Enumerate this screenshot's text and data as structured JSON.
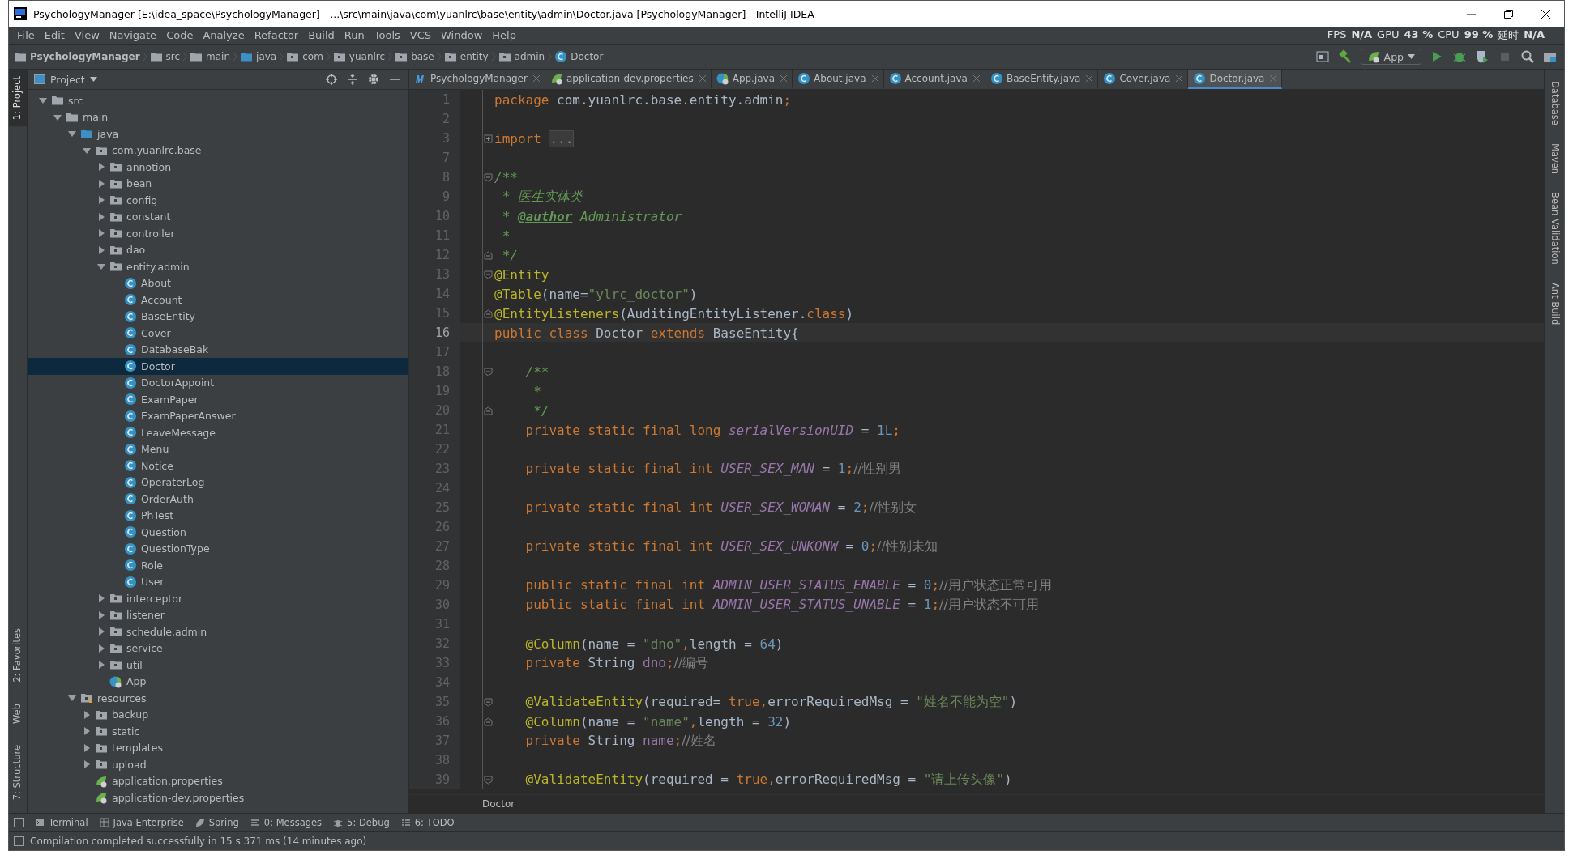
{
  "window": {
    "title": "PsychologyManager [E:\\idea_space\\PsychologyManager] - ...\\src\\main\\java\\com\\yuanlrc\\base\\entity\\admin\\Doctor.java [PsychologyManager] - IntelliJ IDEA"
  },
  "menu": [
    "File",
    "Edit",
    "View",
    "Navigate",
    "Code",
    "Analyze",
    "Refactor",
    "Build",
    "Run",
    "Tools",
    "VCS",
    "Window",
    "Help"
  ],
  "perf_overlay": [
    {
      "label": "FPS",
      "value": "N/A"
    },
    {
      "label": "GPU",
      "value": "43 %"
    },
    {
      "label": "CPU",
      "value": "99 %"
    },
    {
      "label": "延时",
      "value": "N/A"
    }
  ],
  "breadcrumb": [
    {
      "label": "PsychologyManager",
      "kind": "project"
    },
    {
      "label": "src",
      "kind": "folder"
    },
    {
      "label": "main",
      "kind": "folder"
    },
    {
      "label": "java",
      "kind": "source"
    },
    {
      "label": "com",
      "kind": "package"
    },
    {
      "label": "yuanlrc",
      "kind": "package"
    },
    {
      "label": "base",
      "kind": "package"
    },
    {
      "label": "entity",
      "kind": "package"
    },
    {
      "label": "admin",
      "kind": "package"
    },
    {
      "label": "Doctor",
      "kind": "class"
    }
  ],
  "run_config": {
    "label": "App"
  },
  "left_strip": {
    "top": [
      {
        "label": "1: Project",
        "selected": true
      }
    ],
    "bottom": [
      {
        "label": "2: Favorites",
        "selected": false
      },
      {
        "label": "Web",
        "selected": false
      },
      {
        "label": "7: Structure",
        "selected": false
      }
    ]
  },
  "right_strip": [
    "Database",
    "Maven",
    "Bean Validation",
    "Ant Build"
  ],
  "project": {
    "title": "Project",
    "tree": [
      {
        "label": "src",
        "kind": "folder",
        "expanded": true,
        "selected": false,
        "children": [
          {
            "label": "main",
            "kind": "folder",
            "expanded": true,
            "selected": false,
            "children": [
              {
                "label": "java",
                "kind": "source",
                "expanded": true,
                "selected": false,
                "children": [
                  {
                    "label": "com.yuanlrc.base",
                    "kind": "package",
                    "expanded": true,
                    "selected": false,
                    "children": [
                      {
                        "label": "annotion",
                        "kind": "package",
                        "expanded": false,
                        "selected": false
                      },
                      {
                        "label": "bean",
                        "kind": "package",
                        "expanded": false,
                        "selected": false
                      },
                      {
                        "label": "config",
                        "kind": "package",
                        "expanded": false,
                        "selected": false
                      },
                      {
                        "label": "constant",
                        "kind": "package",
                        "expanded": false,
                        "selected": false
                      },
                      {
                        "label": "controller",
                        "kind": "package",
                        "expanded": false,
                        "selected": false
                      },
                      {
                        "label": "dao",
                        "kind": "package",
                        "expanded": false,
                        "selected": false
                      },
                      {
                        "label": "entity.admin",
                        "kind": "package",
                        "expanded": true,
                        "selected": false,
                        "children": [
                          {
                            "label": "About",
                            "kind": "class",
                            "selected": false
                          },
                          {
                            "label": "Account",
                            "kind": "class",
                            "selected": false
                          },
                          {
                            "label": "BaseEntity",
                            "kind": "class",
                            "selected": false
                          },
                          {
                            "label": "Cover",
                            "kind": "class",
                            "selected": false
                          },
                          {
                            "label": "DatabaseBak",
                            "kind": "class",
                            "selected": false
                          },
                          {
                            "label": "Doctor",
                            "kind": "class",
                            "selected": true
                          },
                          {
                            "label": "DoctorAppoint",
                            "kind": "class",
                            "selected": false
                          },
                          {
                            "label": "ExamPaper",
                            "kind": "class",
                            "selected": false
                          },
                          {
                            "label": "ExamPaperAnswer",
                            "kind": "class",
                            "selected": false
                          },
                          {
                            "label": "LeaveMessage",
                            "kind": "class",
                            "selected": false
                          },
                          {
                            "label": "Menu",
                            "kind": "class",
                            "selected": false
                          },
                          {
                            "label": "Notice",
                            "kind": "class",
                            "selected": false
                          },
                          {
                            "label": "OperaterLog",
                            "kind": "class",
                            "selected": false
                          },
                          {
                            "label": "OrderAuth",
                            "kind": "class",
                            "selected": false
                          },
                          {
                            "label": "PhTest",
                            "kind": "class",
                            "selected": false
                          },
                          {
                            "label": "Question",
                            "kind": "class",
                            "selected": false
                          },
                          {
                            "label": "QuestionType",
                            "kind": "class",
                            "selected": false
                          },
                          {
                            "label": "Role",
                            "kind": "class",
                            "selected": false
                          },
                          {
                            "label": "User",
                            "kind": "class",
                            "selected": false
                          }
                        ]
                      },
                      {
                        "label": "interceptor",
                        "kind": "package",
                        "expanded": false,
                        "selected": false
                      },
                      {
                        "label": "listener",
                        "kind": "package",
                        "expanded": false,
                        "selected": false
                      },
                      {
                        "label": "schedule.admin",
                        "kind": "package",
                        "expanded": false,
                        "selected": false
                      },
                      {
                        "label": "service",
                        "kind": "package",
                        "expanded": false,
                        "selected": false
                      },
                      {
                        "label": "util",
                        "kind": "package",
                        "expanded": false,
                        "selected": false
                      },
                      {
                        "label": "App",
                        "kind": "spring-class",
                        "selected": false
                      }
                    ]
                  }
                ]
              },
              {
                "label": "resources",
                "kind": "resources",
                "expanded": true,
                "selected": false,
                "children": [
                  {
                    "label": "backup",
                    "kind": "package",
                    "expanded": false,
                    "selected": false
                  },
                  {
                    "label": "static",
                    "kind": "package",
                    "expanded": false,
                    "selected": false
                  },
                  {
                    "label": "templates",
                    "kind": "package",
                    "expanded": false,
                    "selected": false
                  },
                  {
                    "label": "upload",
                    "kind": "package",
                    "expanded": false,
                    "selected": false
                  },
                  {
                    "label": "application.properties",
                    "kind": "spring-file",
                    "selected": false
                  },
                  {
                    "label": "application-dev.properties",
                    "kind": "spring-file",
                    "selected": false
                  }
                ]
              }
            ]
          }
        ]
      }
    ]
  },
  "editor_tabs": [
    {
      "label": "PsychologyManager",
      "kind": "maven",
      "selected": false
    },
    {
      "label": "application-dev.properties",
      "kind": "spring-file",
      "selected": false
    },
    {
      "label": "App.java",
      "kind": "spring-class",
      "selected": false
    },
    {
      "label": "About.java",
      "kind": "class",
      "selected": false
    },
    {
      "label": "Account.java",
      "kind": "class",
      "selected": false
    },
    {
      "label": "BaseEntity.java",
      "kind": "class",
      "selected": false
    },
    {
      "label": "Cover.java",
      "kind": "class",
      "selected": false
    },
    {
      "label": "Doctor.java",
      "kind": "class",
      "selected": true
    }
  ],
  "code": [
    {
      "number": "1",
      "current": false,
      "tokens": [
        {
          "text": "package ",
          "kind": "keyword"
        },
        {
          "text": "com.yuanlrc.base.entity.admin",
          "kind": "plain"
        },
        {
          "text": ";",
          "kind": "keyword"
        }
      ]
    },
    {
      "number": "2",
      "current": false
    },
    {
      "number": "3",
      "current": false,
      "fold": {
        "kind": "collapsed"
      },
      "tokens": [
        {
          "text": "import ",
          "kind": "keyword"
        },
        {
          "text": "...",
          "kind": "folded"
        }
      ]
    },
    {
      "number": "7",
      "current": false
    },
    {
      "number": "8",
      "current": false,
      "fold": {
        "kind": "start"
      },
      "tokens": [
        {
          "text": "/**",
          "kind": "doc"
        }
      ]
    },
    {
      "number": "9",
      "current": false,
      "tokens": [
        {
          "text": " * 医生实体类",
          "kind": "doc"
        }
      ]
    },
    {
      "number": "10",
      "current": false,
      "tokens": [
        {
          "text": " * ",
          "kind": "doc"
        },
        {
          "text": "@author",
          "kind": "tag"
        },
        {
          "text": " Administrator",
          "kind": "doc"
        }
      ]
    },
    {
      "number": "11",
      "current": false,
      "tokens": [
        {
          "text": " *",
          "kind": "doc"
        }
      ]
    },
    {
      "number": "12",
      "current": false,
      "fold": {
        "kind": "end"
      },
      "tokens": [
        {
          "text": " */",
          "kind": "doc"
        }
      ]
    },
    {
      "number": "13",
      "current": false,
      "fold": {
        "kind": "start"
      },
      "tokens": [
        {
          "text": "@Entity",
          "kind": "annotation"
        }
      ]
    },
    {
      "number": "14",
      "current": false,
      "tokens": [
        {
          "text": "@Table",
          "kind": "annotation"
        },
        {
          "text": "(name=",
          "kind": "plain"
        },
        {
          "text": "\"ylrc_doctor\"",
          "kind": "string"
        },
        {
          "text": ")",
          "kind": "plain"
        }
      ]
    },
    {
      "number": "15",
      "current": false,
      "fold": {
        "kind": "end"
      },
      "tokens": [
        {
          "text": "@EntityListeners",
          "kind": "annotation"
        },
        {
          "text": "(AuditingEntityListener.",
          "kind": "plain"
        },
        {
          "text": "class",
          "kind": "keyword"
        },
        {
          "text": ")",
          "kind": "plain"
        }
      ]
    },
    {
      "number": "16",
      "current": true,
      "tokens": [
        {
          "text": "public class ",
          "kind": "keyword"
        },
        {
          "text": "Doctor",
          "kind": "plain"
        },
        {
          "text": " extends ",
          "kind": "keyword"
        },
        {
          "text": "BaseEntity{",
          "kind": "plain"
        }
      ]
    },
    {
      "number": "17",
      "current": false
    },
    {
      "number": "18",
      "current": false,
      "fold": {
        "kind": "start"
      },
      "tokens": [
        {
          "text": "    /**",
          "kind": "doc"
        }
      ]
    },
    {
      "number": "19",
      "current": false,
      "tokens": [
        {
          "text": "     *",
          "kind": "doc"
        }
      ]
    },
    {
      "number": "20",
      "current": false,
      "fold": {
        "kind": "end"
      },
      "tokens": [
        {
          "text": "     */",
          "kind": "doc"
        }
      ]
    },
    {
      "number": "21",
      "current": false,
      "tokens": [
        {
          "text": "    private static final long ",
          "kind": "keyword"
        },
        {
          "text": "serialVersionUID",
          "kind": "field"
        },
        {
          "text": " = ",
          "kind": "plain"
        },
        {
          "text": "1L",
          "kind": "number"
        },
        {
          "text": ";",
          "kind": "keyword"
        }
      ]
    },
    {
      "number": "22",
      "current": false
    },
    {
      "number": "23",
      "current": false,
      "tokens": [
        {
          "text": "    private static final int ",
          "kind": "keyword"
        },
        {
          "text": "USER_SEX_MAN",
          "kind": "field"
        },
        {
          "text": " = ",
          "kind": "plain"
        },
        {
          "text": "1",
          "kind": "number"
        },
        {
          "text": ";",
          "kind": "keyword"
        },
        {
          "text": "//性别男",
          "kind": "comment"
        }
      ]
    },
    {
      "number": "24",
      "current": false
    },
    {
      "number": "25",
      "current": false,
      "tokens": [
        {
          "text": "    private static final int ",
          "kind": "keyword"
        },
        {
          "text": "USER_SEX_WOMAN",
          "kind": "field"
        },
        {
          "text": " = ",
          "kind": "plain"
        },
        {
          "text": "2",
          "kind": "number"
        },
        {
          "text": ";",
          "kind": "keyword"
        },
        {
          "text": "//性别女",
          "kind": "comment"
        }
      ]
    },
    {
      "number": "26",
      "current": false
    },
    {
      "number": "27",
      "current": false,
      "tokens": [
        {
          "text": "    private static final int ",
          "kind": "keyword"
        },
        {
          "text": "USER_SEX_UNKONW",
          "kind": "field"
        },
        {
          "text": " = ",
          "kind": "plain"
        },
        {
          "text": "0",
          "kind": "number"
        },
        {
          "text": ";",
          "kind": "keyword"
        },
        {
          "text": "//性别未知",
          "kind": "comment"
        }
      ]
    },
    {
      "number": "28",
      "current": false
    },
    {
      "number": "29",
      "current": false,
      "tokens": [
        {
          "text": "    public static final int ",
          "kind": "keyword"
        },
        {
          "text": "ADMIN_USER_STATUS_ENABLE",
          "kind": "field"
        },
        {
          "text": " = ",
          "kind": "plain"
        },
        {
          "text": "0",
          "kind": "number"
        },
        {
          "text": ";",
          "kind": "keyword"
        },
        {
          "text": "//用户状态正常可用",
          "kind": "comment"
        }
      ]
    },
    {
      "number": "30",
      "current": false,
      "tokens": [
        {
          "text": "    public static final int ",
          "kind": "keyword"
        },
        {
          "text": "ADMIN_USER_STATUS_UNABLE",
          "kind": "field"
        },
        {
          "text": " = ",
          "kind": "plain"
        },
        {
          "text": "1",
          "kind": "number"
        },
        {
          "text": ";",
          "kind": "keyword"
        },
        {
          "text": "//用户状态不可用",
          "kind": "comment"
        }
      ]
    },
    {
      "number": "31",
      "current": false
    },
    {
      "number": "32",
      "current": false,
      "tokens": [
        {
          "text": "    @Column",
          "kind": "annotation"
        },
        {
          "text": "(name = ",
          "kind": "plain"
        },
        {
          "text": "\"dno\"",
          "kind": "string"
        },
        {
          "text": ",",
          "kind": "keyword"
        },
        {
          "text": "length = ",
          "kind": "plain"
        },
        {
          "text": "64",
          "kind": "number"
        },
        {
          "text": ")",
          "kind": "plain"
        }
      ]
    },
    {
      "number": "33",
      "current": false,
      "tokens": [
        {
          "text": "    private ",
          "kind": "keyword"
        },
        {
          "text": "String ",
          "kind": "plain"
        },
        {
          "text": "dno",
          "kind": "member"
        },
        {
          "text": ";",
          "kind": "keyword"
        },
        {
          "text": "//编号",
          "kind": "comment"
        }
      ]
    },
    {
      "number": "34",
      "current": false
    },
    {
      "number": "35",
      "current": false,
      "fold": {
        "kind": "start"
      },
      "tokens": [
        {
          "text": "    @ValidateEntity",
          "kind": "annotation"
        },
        {
          "text": "(required= ",
          "kind": "plain"
        },
        {
          "text": "true,",
          "kind": "keyword"
        },
        {
          "text": "errorRequiredMsg = ",
          "kind": "plain"
        },
        {
          "text": "\"姓名不能为空\"",
          "kind": "string"
        },
        {
          "text": ")",
          "kind": "plain"
        }
      ]
    },
    {
      "number": "36",
      "current": false,
      "fold": {
        "kind": "end"
      },
      "tokens": [
        {
          "text": "    @Column",
          "kind": "annotation"
        },
        {
          "text": "(name = ",
          "kind": "plain"
        },
        {
          "text": "\"name\"",
          "kind": "string"
        },
        {
          "text": ",",
          "kind": "keyword"
        },
        {
          "text": "length = ",
          "kind": "plain"
        },
        {
          "text": "32",
          "kind": "number"
        },
        {
          "text": ")",
          "kind": "plain"
        }
      ]
    },
    {
      "number": "37",
      "current": false,
      "tokens": [
        {
          "text": "    private ",
          "kind": "keyword"
        },
        {
          "text": "String ",
          "kind": "plain"
        },
        {
          "text": "name",
          "kind": "member"
        },
        {
          "text": ";",
          "kind": "keyword"
        },
        {
          "text": "//姓名",
          "kind": "comment"
        }
      ]
    },
    {
      "number": "38",
      "current": false
    },
    {
      "number": "39",
      "current": false,
      "fold": {
        "kind": "start"
      },
      "tokens": [
        {
          "text": "    @ValidateEntity",
          "kind": "annotation"
        },
        {
          "text": "(required = ",
          "kind": "plain"
        },
        {
          "text": "true,",
          "kind": "keyword"
        },
        {
          "text": "errorRequiredMsg = ",
          "kind": "plain"
        },
        {
          "text": "\"请上传头像\"",
          "kind": "string"
        },
        {
          "text": ")",
          "kind": "plain"
        }
      ]
    }
  ],
  "editor_breadcrumb": "Doctor",
  "tool_tabs": [
    {
      "label": "Terminal",
      "kind": "terminal"
    },
    {
      "label": "Java Enterprise",
      "kind": "enterprise"
    },
    {
      "label": "Spring",
      "kind": "spring"
    },
    {
      "label": "0: Messages",
      "kind": "messages"
    },
    {
      "label": "5: Debug",
      "kind": "debug"
    },
    {
      "label": "6: TODO",
      "kind": "todo"
    }
  ],
  "status_bar": "Compilation completed successfully in 15 s 371 ms (14 minutes ago)"
}
